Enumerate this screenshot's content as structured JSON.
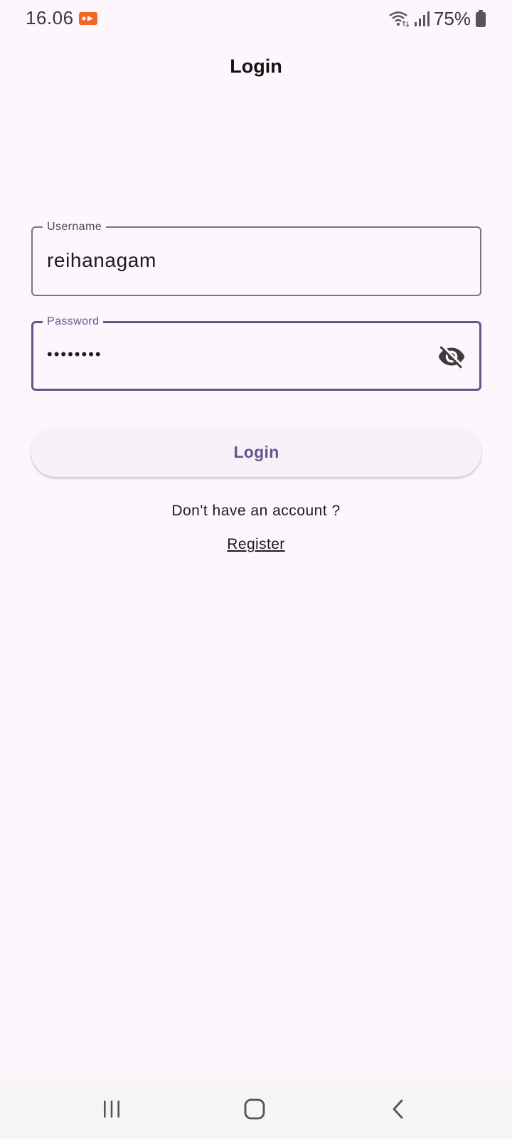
{
  "status_bar": {
    "time": "16.06",
    "battery_percent": "75%",
    "icons": [
      "screen-record-icon",
      "wifi-icon",
      "signal-icon",
      "battery-icon"
    ],
    "record_color": "#f26522"
  },
  "app_bar": {
    "title": "Login"
  },
  "form": {
    "username": {
      "label": "Username",
      "value": "reihanagam"
    },
    "password": {
      "label": "Password",
      "value": "••••••••",
      "visibility_icon": "visibility-off-icon"
    },
    "login_label": "Login",
    "no_account_text": "Don't have an account ?",
    "register_label": "Register"
  },
  "nav_bar": {
    "icons": [
      "recents-icon",
      "home-icon",
      "back-icon"
    ]
  },
  "colors": {
    "background": "#fdf7fd",
    "primary": "#65558f",
    "outline": "#79747e",
    "button_bg": "#f7f2f7"
  }
}
